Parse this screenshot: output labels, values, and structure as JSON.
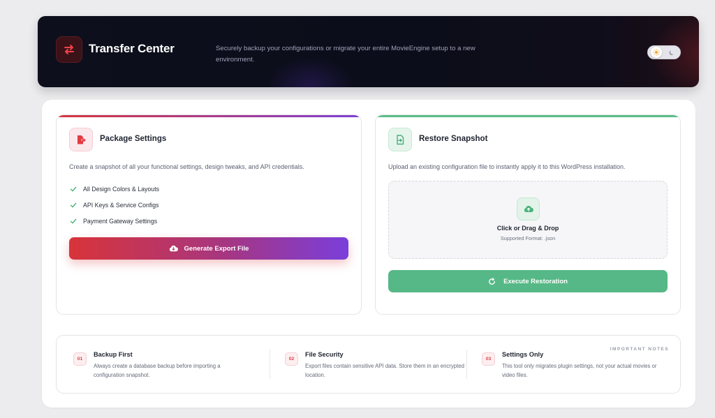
{
  "header": {
    "title": "Transfer Center",
    "description": "Securely backup your configurations or migrate your entire MovieEngine setup to a new environment.",
    "logo_icon": "transfer-arrows-icon",
    "toggle_icons": [
      "sun-icon",
      "moon-icon"
    ]
  },
  "export_card": {
    "title": "Package Settings",
    "description": "Create a snapshot of all your functional settings, design tweaks, and API credentials.",
    "icon": "file-export-icon",
    "features": [
      "All Design Colors & Layouts",
      "API Keys & Service Configs",
      "Payment Gateway Settings"
    ],
    "button_label": "Generate Export File",
    "button_icon": "cloud-download-icon"
  },
  "restore_card": {
    "title": "Restore Snapshot",
    "description": "Upload an existing configuration file to instantly apply it to this WordPress installation.",
    "icon": "file-import-icon",
    "dropzone_title": "Click or Drag & Drop",
    "dropzone_subtitle": "Supported Format: .json",
    "dropzone_icon": "cloud-upload-icon",
    "button_label": "Execute Restoration",
    "button_icon": "refresh-icon"
  },
  "notes": {
    "tag": "IMPORTANT NOTES",
    "items": [
      {
        "number": "01",
        "title": "Backup First",
        "text": "Always create a database backup before importing a configuration snapshot."
      },
      {
        "number": "02",
        "title": "File Security",
        "text": "Export files contain sensitive API data. Store them in an encrypted location."
      },
      {
        "number": "03",
        "title": "Settings Only",
        "text": "This tool only migrates plugin settings, not your actual movies or video files."
      }
    ]
  },
  "colors": {
    "accent_red": "#d8353b",
    "accent_purple": "#7e3fd4",
    "accent_green": "#56b886",
    "header_bg": "#0d0f1c"
  }
}
